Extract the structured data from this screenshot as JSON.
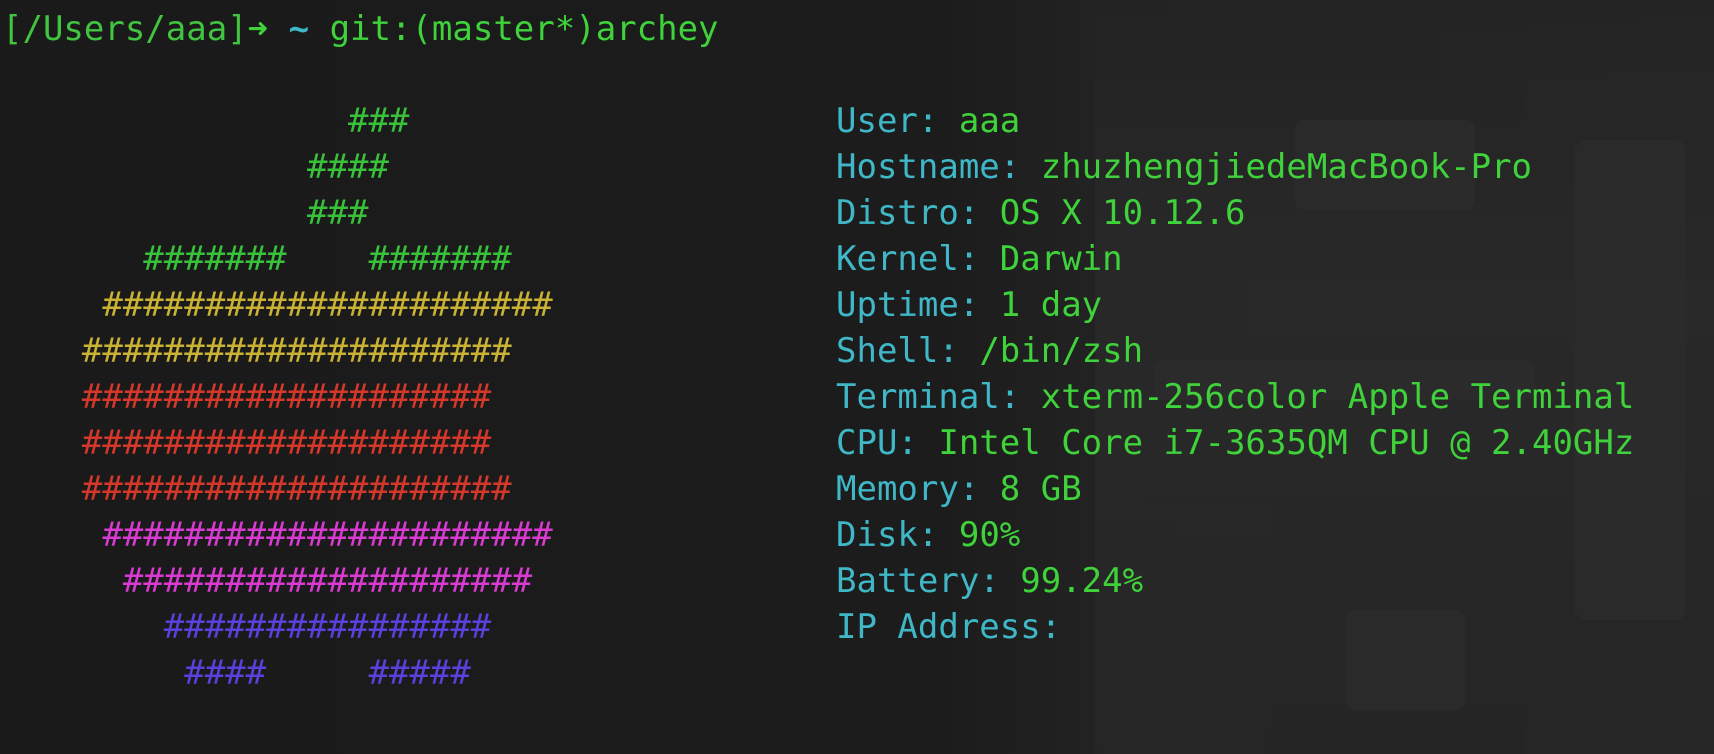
{
  "prompt": {
    "path": "[/Users/aaa]",
    "arrow": "➜",
    "tilde": "~",
    "git": "git:(master*)",
    "command": "archey"
  },
  "logo": {
    "colors": {
      "green": "#38c23a",
      "yellow": "#c9b234",
      "red": "#d5382a",
      "magenta": "#d93ad2",
      "blue": "#5b40dd"
    },
    "lines": [
      {
        "text": "                 ###",
        "color": "#38c23a"
      },
      {
        "text": "               ####",
        "color": "#38c23a"
      },
      {
        "text": "               ###",
        "color": "#38c23a"
      },
      {
        "text": "       #######    #######",
        "color": "#38c23a"
      },
      {
        "text": "     ######################",
        "color": "#c9b234"
      },
      {
        "text": "    #####################",
        "color": "#c9b234"
      },
      {
        "text": "    ####################",
        "color": "#d5382a"
      },
      {
        "text": "    ####################",
        "color": "#d5382a"
      },
      {
        "text": "    #####################",
        "color": "#d5382a"
      },
      {
        "text": "     ######################",
        "color": "#d93ad2"
      },
      {
        "text": "      ####################",
        "color": "#d93ad2"
      },
      {
        "text": "        ################",
        "color": "#5b40dd"
      },
      {
        "text": "         ####     #####",
        "color": "#5b40dd"
      }
    ]
  },
  "info": [
    {
      "key": "User:",
      "value": "aaa"
    },
    {
      "key": "Hostname:",
      "value": "zhuzhengjiedeMacBook-Pro"
    },
    {
      "key": "Distro:",
      "value": "OS X 10.12.6"
    },
    {
      "key": "Kernel:",
      "value": "Darwin"
    },
    {
      "key": "Uptime:",
      "value": "1 day"
    },
    {
      "key": "Shell:",
      "value": "/bin/zsh"
    },
    {
      "key": "Terminal:",
      "value": "xterm-256color Apple Terminal"
    },
    {
      "key": "CPU:",
      "value": "Intel Core i7-3635QM CPU @ 2.40GHz"
    },
    {
      "key": "Memory:",
      "value": "8 GB"
    },
    {
      "key": "Disk:",
      "value": "90%"
    },
    {
      "key": "Battery:",
      "value": "99.24%"
    },
    {
      "key": "IP Address:",
      "value": ""
    }
  ]
}
